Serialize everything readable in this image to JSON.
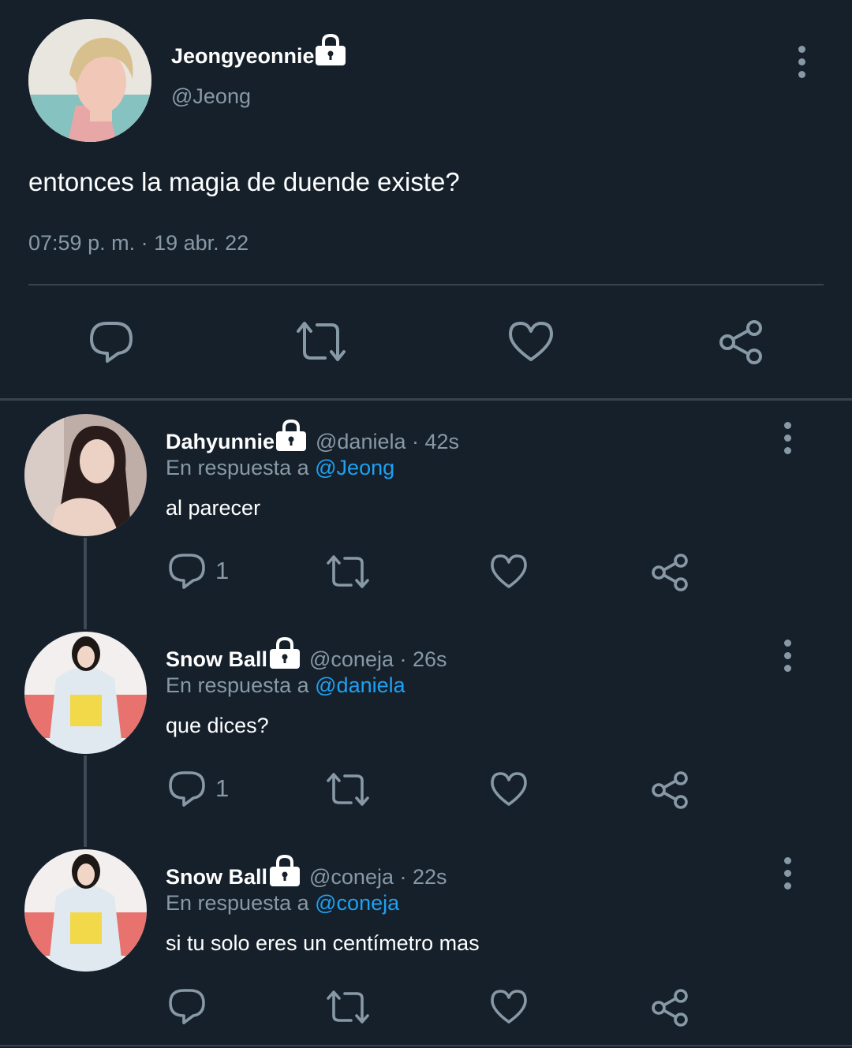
{
  "main_tweet": {
    "display_name": "Jeongyeonnie",
    "handle": "@Jeong",
    "text": "entonces la magia de duende existe?",
    "timestamp": "07:59 p. m. · 19 abr. 22",
    "avatar_colors": {
      "bg": "#ece9e4",
      "hair": "#d8bf8e",
      "skin": "#f1c8b7",
      "shirt": "#86c2bf"
    }
  },
  "replies": [
    {
      "display_name": "Dahyunnie",
      "meta": "@daniela · 42s",
      "reply_prefix": "En respuesta a",
      "reply_to": "@Jeong",
      "text": "al parecer",
      "reply_count": "1",
      "avatar_colors": {
        "bg": "#c9b8b0",
        "hair": "#2a1c1a",
        "skin": "#ecd2c4"
      }
    },
    {
      "display_name": "Snow Ball",
      "meta": "@coneja · 26s",
      "reply_prefix": "En respuesta a",
      "reply_to": "@daniela",
      "text": "que dices?",
      "reply_count": "1",
      "avatar_colors": {
        "bg": "#f2efee",
        "floor": "#e7726e",
        "hair": "#1d1816",
        "outfit": "#dfe9ef",
        "yellow": "#f2d94a"
      }
    },
    {
      "display_name": "Snow Ball",
      "meta": "@coneja · 22s",
      "reply_prefix": "En respuesta a",
      "reply_to": "@coneja",
      "text": "si tu solo eres un centímetro mas",
      "reply_count": "",
      "avatar_colors": {
        "bg": "#f2efee",
        "floor": "#e7726e",
        "hair": "#1d1816",
        "outfit": "#dfe9ef",
        "yellow": "#f2d94a"
      }
    }
  ],
  "icons": [
    "lock-icon",
    "more-icon",
    "reply-icon",
    "retweet-icon",
    "like-icon",
    "share-icon"
  ],
  "theme": {
    "background": "#15202b",
    "muted": "#8899a6",
    "link": "#1da1f2",
    "divider": "#38444d"
  }
}
